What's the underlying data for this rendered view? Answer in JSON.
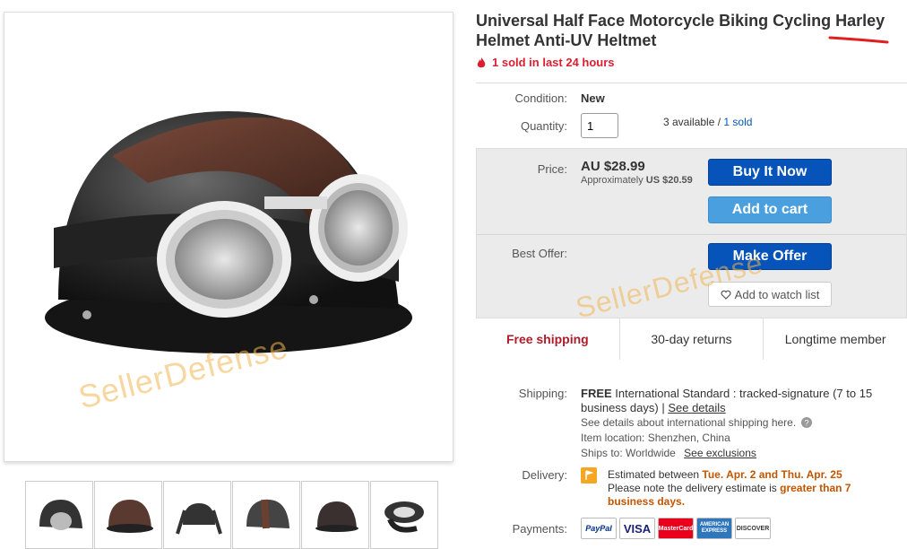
{
  "title": "Universal Half Face Motorcycle Biking Cycling Harley Helmet Anti-UV Heltmet",
  "sold_text": "1 sold in last 24 hours",
  "condition": {
    "label": "Condition:",
    "value": "New"
  },
  "quantity": {
    "label": "Quantity:",
    "value": "1",
    "available": "3 available /",
    "sold_link": "1 sold"
  },
  "price": {
    "label": "Price:",
    "value": "AU $28.99",
    "approx_prefix": "Approximately",
    "approx_value": "US $20.59"
  },
  "buttons": {
    "buy_now": "Buy It Now",
    "add_cart": "Add to cart",
    "make_offer": "Make Offer",
    "watch": "Add to watch list"
  },
  "best_offer_label": "Best Offer:",
  "strip": {
    "shipping": "Free shipping",
    "returns": "30-day returns",
    "member": "Longtime member"
  },
  "shipping": {
    "label": "Shipping:",
    "free": "FREE",
    "method": "International Standard : tracked-signature (7 to 15 business days) |",
    "see_details": "See details",
    "intl_note": "See details about international shipping here.",
    "item_location": "Item location:  Shenzhen, China",
    "ships_to_prefix": "Ships to:  Worldwide",
    "see_exclusions": "See exclusions"
  },
  "delivery": {
    "label": "Delivery:",
    "est_prefix": "Estimated between",
    "est_dates": "Tue. Apr. 2 and Thu. Apr. 25",
    "note_prefix": "Please note the delivery estimate is",
    "note_emph": "greater than 7 business days."
  },
  "payments": {
    "label": "Payments:",
    "methods": [
      "PayPal",
      "VISA",
      "MasterCard",
      "AMERICAN EXPRESS",
      "DISCOVER"
    ]
  },
  "watermark": "SellerDefense",
  "colors": {
    "accent_blue": "#0654ba",
    "light_blue": "#4aa0df",
    "red": "#dd1e31",
    "orange_text": "#c45500"
  }
}
